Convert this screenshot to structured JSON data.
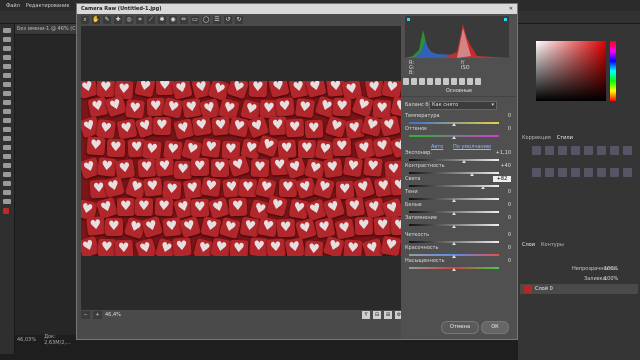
{
  "photoshop": {
    "menu": [
      "Файл",
      "Редактирование"
    ],
    "doc_tab": "Без имени-1 @ 46% (Слой",
    "status": {
      "zoom": "46,03%",
      "doc": "Док: 2,63M/2,..."
    },
    "right_tabs": [
      "Коррекция",
      "Стили"
    ],
    "layer_tabs": [
      "Слои",
      "Контуры"
    ],
    "layer_opacity_label": "Непрозрачность:",
    "layer_opacity": "100%",
    "layer_fill_label": "Заливка:",
    "layer_fill": "100%",
    "layer_name": "Слой 0"
  },
  "camera_raw": {
    "title": "Camera Raw (Untitled-1.jpg)",
    "close_glyph": "✕",
    "zoom_value": "46,4%",
    "view_buttons": [
      "Y",
      "⊟",
      "⊞",
      "⚙"
    ],
    "readout": [
      "R:",
      "G:",
      "B:",
      "f/",
      "ISO"
    ],
    "panel_header": "Основные",
    "white_balance_label": "Баланс белого:",
    "white_balance_value": "Как снято",
    "auto_link": "Авто",
    "default_link": "По умолчанию",
    "sliders": [
      {
        "label": "Температура",
        "value": "0"
      },
      {
        "label": "Оттенок",
        "value": "0"
      },
      {
        "label": "Экспонир.",
        "value": "+1,10"
      },
      {
        "label": "Контрастность",
        "value": "+40"
      },
      {
        "label": "Света",
        "value": "+82"
      },
      {
        "label": "Тени",
        "value": "0"
      },
      {
        "label": "Белые",
        "value": "0"
      },
      {
        "label": "Затемнение",
        "value": "0"
      },
      {
        "label": "Четкость",
        "value": "0"
      },
      {
        "label": "Красочность",
        "value": "0"
      },
      {
        "label": "Насыщенность",
        "value": "0"
      }
    ],
    "cancel_label": "Отмена",
    "ok_label": "ОК"
  },
  "colors": {
    "image_bg": "#7a1518",
    "tile": "#b2272b",
    "heart": "#e6dfdf",
    "dialog_bg": "#4a4a4a"
  }
}
